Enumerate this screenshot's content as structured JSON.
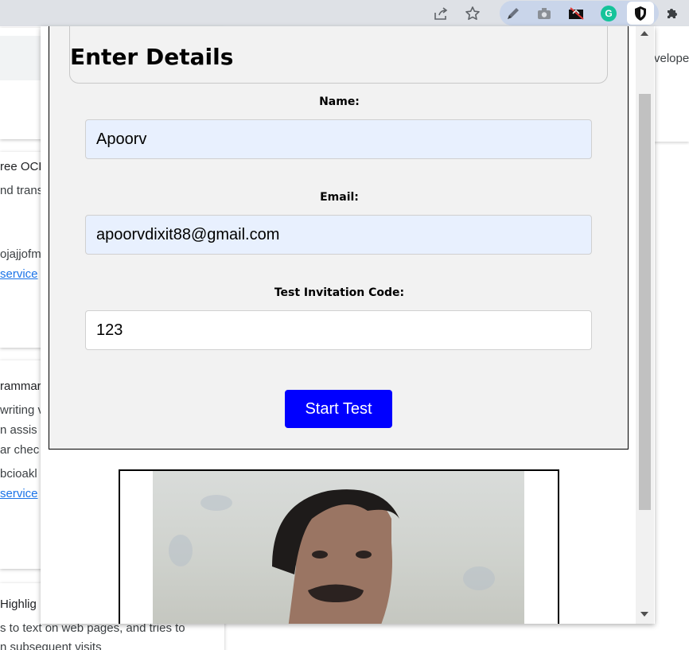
{
  "toolbar": {
    "icons": [
      "share-icon",
      "star-icon",
      "pen-icon",
      "camera-icon",
      "ext-dark-icon",
      "grammarly-icon",
      "shield-icon",
      "puzzle-icon"
    ],
    "grammarly_letter": "G"
  },
  "background_page": {
    "cards": [
      {
        "title": "ree OCR",
        "line1": "nd trans",
        "id_text": "ojajjofm",
        "link": "service"
      },
      {
        "title": "rammar",
        "line1": "writing v",
        "line2": "n assis",
        "line3": "ar chec",
        "id_text": "bcioakl",
        "link": "service"
      },
      {
        "title": "Highlig",
        "line1": "s to text on web pages, and tries to",
        "line2": "n subsequent visits"
      }
    ],
    "right_text": "veloper"
  },
  "form": {
    "title": "Enter Details",
    "name_label": "Name:",
    "name_value": "Apoorv",
    "email_label": "Email:",
    "email_value": "apoorvdixit88@gmail.com",
    "code_label": "Test Invitation Code:",
    "code_value": "123",
    "submit_label": "Start Test"
  },
  "colors": {
    "button": "#0000ff",
    "autofill": "#e8f0fe",
    "panel": "#f2f2f2"
  }
}
